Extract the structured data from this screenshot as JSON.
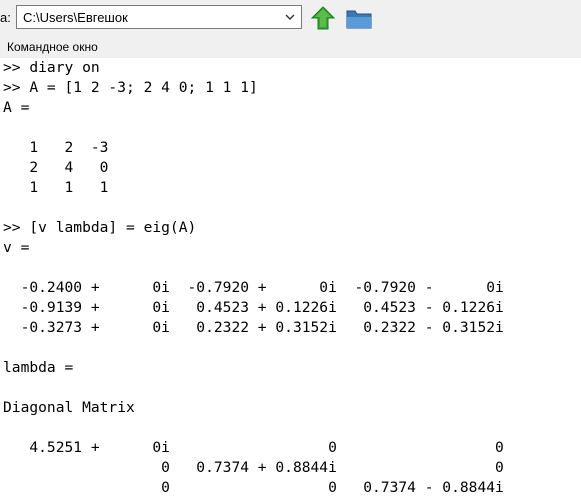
{
  "toolbar": {
    "dir_prefix": "a:",
    "current_folder": "C:\\Users\\Евгешок"
  },
  "panel": {
    "title": "Командное окно"
  },
  "console": {
    "lines": [
      ">> diary on",
      ">> A = [1 2 -3; 2 4 0; 1 1 1]",
      "A =",
      "",
      "   1   2  -3",
      "   2   4   0",
      "   1   1   1",
      "",
      ">> [v lambda] = eig(A)",
      "v =",
      "",
      "  -0.2400 +      0i  -0.7920 +      0i  -0.7920 -      0i",
      "  -0.9139 +      0i   0.4523 + 0.1226i   0.4523 - 0.1226i",
      "  -0.3273 +      0i   0.2322 + 0.3152i   0.2322 - 0.3152i",
      "",
      "lambda =",
      "",
      "Diagonal Matrix",
      "",
      "   4.5251 +      0i                  0                  0",
      "                  0   0.7374 + 0.8844i                  0",
      "                  0                  0   0.7374 - 0.8844i"
    ]
  }
}
